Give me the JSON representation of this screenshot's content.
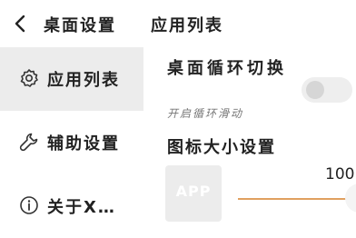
{
  "header": {
    "breadcrumb_parent": "桌面设置",
    "breadcrumb_current": "应用列表"
  },
  "sidebar": {
    "items": [
      {
        "label": "应用列表",
        "icon": "gear-icon",
        "active": true
      },
      {
        "label": "辅助设置",
        "icon": "wrench-icon",
        "active": false
      },
      {
        "label": "关于X…",
        "icon": "info-icon",
        "active": false
      }
    ]
  },
  "main": {
    "switch_option": {
      "title": "桌面循环切换",
      "subtitle": "开启循环滑动",
      "enabled": false
    },
    "icon_size": {
      "title": "图标大小设置",
      "preview_label": "APP",
      "value": "100"
    }
  },
  "colors": {
    "accent": "#e0a060",
    "active_item_bg": "#ececec",
    "preview_bg": "#ececec",
    "text": "#222222",
    "subtext": "#777777"
  }
}
